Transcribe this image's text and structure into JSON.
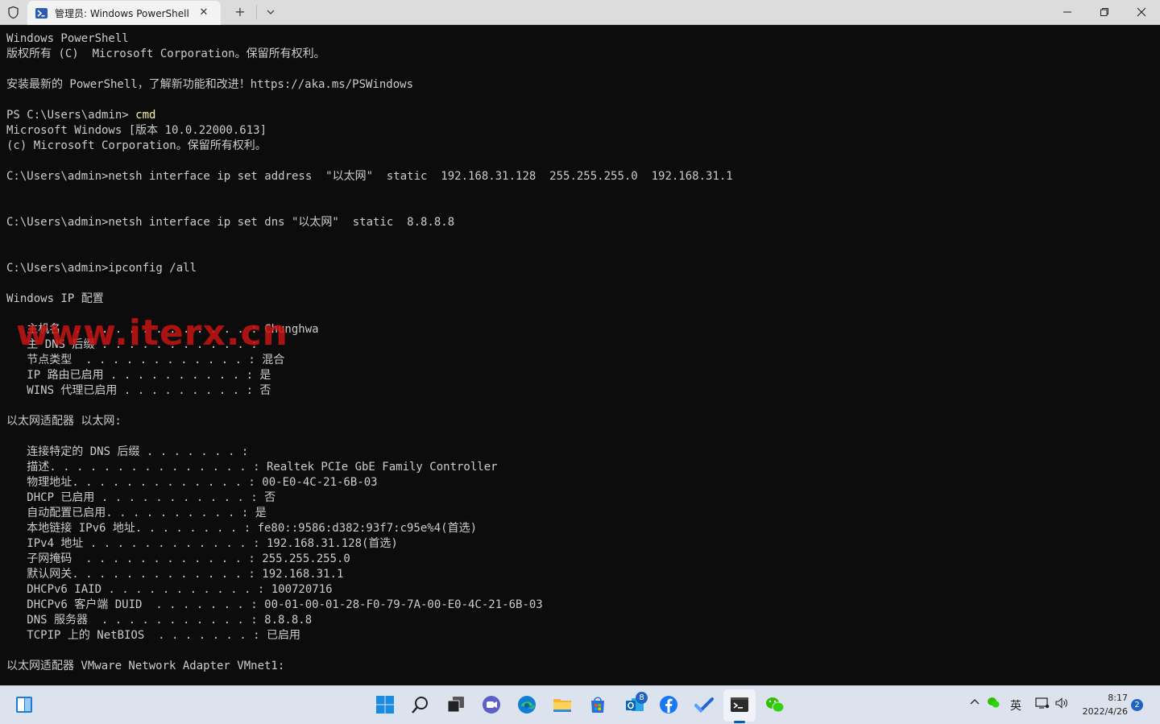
{
  "window": {
    "tab_title": "管理员: Windows PowerShell",
    "close_tab_glyph": "✕",
    "new_tab_glyph": "+"
  },
  "terminal": {
    "lines": [
      "Windows PowerShell",
      "版权所有 (C)  Microsoft Corporation。保留所有权利。",
      "",
      "安装最新的 PowerShell，了解新功能和改进！https://aka.ms/PSWindows",
      "",
      "PS C:\\Users\\admin> ",
      "Microsoft Windows [版本 10.0.22000.613]",
      "(c) Microsoft Corporation。保留所有权利。",
      "",
      "C:\\Users\\admin>netsh interface ip set address  \"以太网\"  static  192.168.31.128  255.255.255.0  192.168.31.1",
      "",
      "",
      "C:\\Users\\admin>netsh interface ip set dns \"以太网\"  static  8.8.8.8",
      "",
      "",
      "C:\\Users\\admin>ipconfig /all",
      "",
      "Windows IP 配置",
      "",
      "   主机名  . . . . . . . . . . . . . : Chunghwa",
      "   主 DNS 后缀 . . . . . . . . . . . :",
      "   节点类型  . . . . . . . . . . . . : 混合",
      "   IP 路由已启用 . . . . . . . . . . : 是",
      "   WINS 代理已启用 . . . . . . . . . : 否",
      "",
      "以太网适配器 以太网:",
      "",
      "   连接特定的 DNS 后缀 . . . . . . . :",
      "   描述. . . . . . . . . . . . . . . : Realtek PCIe GbE Family Controller",
      "   物理地址. . . . . . . . . . . . . : 00-E0-4C-21-6B-03",
      "   DHCP 已启用 . . . . . . . . . . . : 否",
      "   自动配置已启用. . . . . . . . . . : 是",
      "   本地链接 IPv6 地址. . . . . . . . : fe80::9586:d382:93f7:c95e%4(首选)",
      "   IPv4 地址 . . . . . . . . . . . . : 192.168.31.128(首选)",
      "   子网掩码  . . . . . . . . . . . . : 255.255.255.0",
      "   默认网关. . . . . . . . . . . . . : 192.168.31.1",
      "   DHCPv6 IAID . . . . . . . . . . . : 100720716",
      "   DHCPv6 客户端 DUID  . . . . . . . : 00-01-00-01-28-F0-79-7A-00-E0-4C-21-6B-03",
      "   DNS 服务器  . . . . . . . . . . . : 8.8.8.8",
      "   TCPIP 上的 NetBIOS  . . . . . . . : 已启用",
      "",
      "以太网适配器 VMware Network Adapter VMnet1:"
    ],
    "typed_command": "cmd",
    "watermark": "www.iterx.cn"
  },
  "taskbar": {
    "store_badge": "8",
    "ime_label": "英",
    "clock_time": "8:17",
    "clock_date": "2022/4/26",
    "notification_count": "2",
    "icons": [
      "widgets-icon",
      "start-icon",
      "search-icon",
      "task-view-icon",
      "teams-chat-icon",
      "edge-icon",
      "file-explorer-icon",
      "store-icon",
      "outlook-icon",
      "facebook-icon",
      "todo-icon",
      "terminal-icon",
      "wechat-icon"
    ]
  },
  "colors": {
    "terminal_bg": "#0c0c0c",
    "terminal_text": "#cccccc",
    "command_yellow": "#f9f1a5",
    "watermark_red": "#c81414",
    "taskbar_bg": "#dde3ee",
    "accent": "#005fb8"
  }
}
